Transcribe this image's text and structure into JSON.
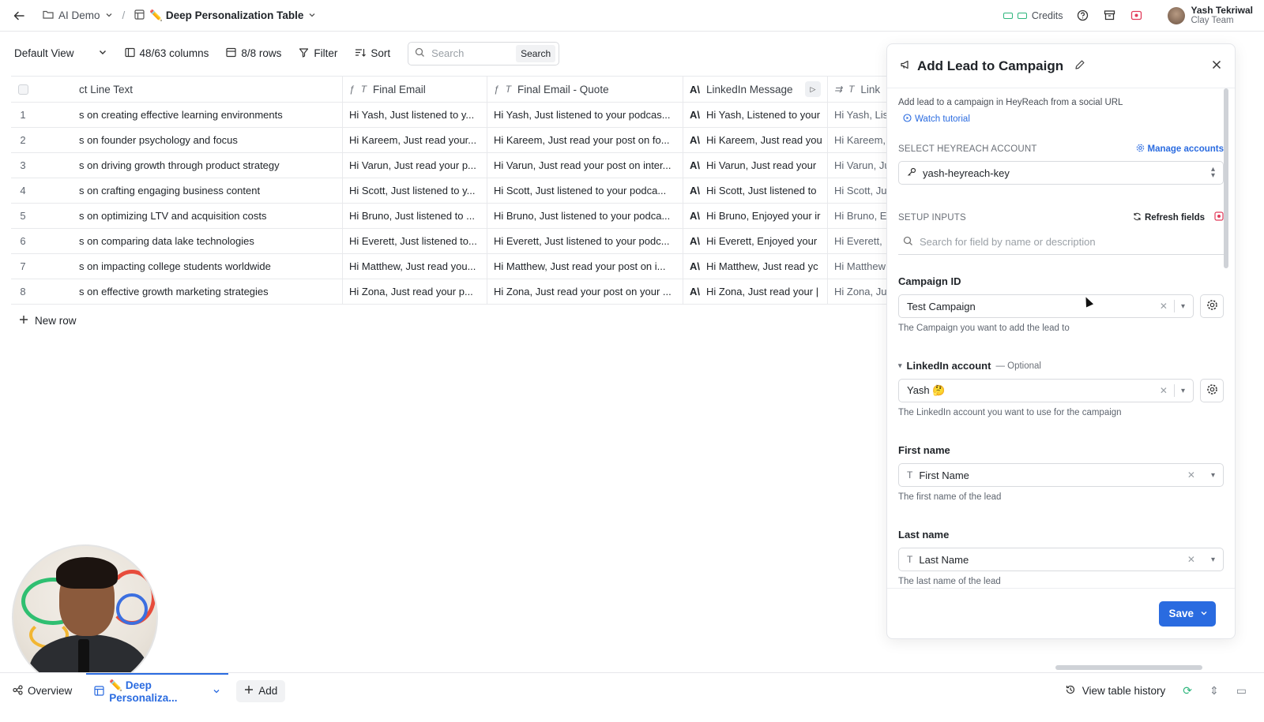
{
  "topbar": {
    "workspace": "AI Demo",
    "table": "✏️ Deep Personalization Table",
    "credits_label": "Credits",
    "user_name": "Yash Tekriwal",
    "user_team": "Clay Team"
  },
  "toolbar": {
    "view": "Default View",
    "columns": "48/63 columns",
    "rows": "8/8 rows",
    "filter": "Filter",
    "sort": "Sort",
    "search_placeholder": "Search",
    "search_button": "Search"
  },
  "grid": {
    "headers": [
      "ct Line Text",
      "Final Email",
      "Final Email - Quote",
      "LinkedIn Message",
      "Link"
    ],
    "rows": [
      {
        "n": "1",
        "c1": "s on creating effective learning environments",
        "c2": "Hi Yash, Just listened to y...",
        "c3": "Hi Yash, Just listened to your podcas...",
        "c4": "Hi Yash, Listened to your",
        "c5": "Hi Yash, Lis"
      },
      {
        "n": "2",
        "c1": "s on founder psychology and focus",
        "c2": "Hi Kareem, Just read your...",
        "c3": "Hi Kareem, Just read your post on fo...",
        "c4": "Hi Kareem, Just read you",
        "c5": "Hi Kareem,"
      },
      {
        "n": "3",
        "c1": "s on driving growth through product strategy",
        "c2": "Hi Varun, Just read your p...",
        "c3": "Hi Varun, Just read your post on inter...",
        "c4": "Hi Varun, Just read your",
        "c5": "Hi Varun, Ju"
      },
      {
        "n": "4",
        "c1": "s on crafting engaging business content",
        "c2": "Hi Scott, Just listened to y...",
        "c3": "Hi Scott, Just listened to your podca...",
        "c4": "Hi Scott, Just listened to",
        "c5": "Hi Scott, Ju"
      },
      {
        "n": "5",
        "c1": "s on optimizing LTV and acquisition costs",
        "c2": "Hi Bruno, Just listened to ...",
        "c3": "Hi Bruno, Just listened to your podca...",
        "c4": "Hi Bruno, Enjoyed your ir",
        "c5": "Hi Bruno, E"
      },
      {
        "n": "6",
        "c1": "s on comparing data lake technologies",
        "c2": "Hi Everett, Just listened to...",
        "c3": "Hi Everett, Just listened to your podc...",
        "c4": "Hi Everett, Enjoyed your",
        "c5": "Hi Everett,"
      },
      {
        "n": "7",
        "c1": "s on impacting college students worldwide",
        "c2": "Hi Matthew, Just read you...",
        "c3": "Hi Matthew, Just read your post on i...",
        "c4": "Hi Matthew, Just read yc",
        "c5": "Hi Matthew"
      },
      {
        "n": "8",
        "c1": "s on effective growth marketing strategies",
        "c2": "Hi Zona, Just read your p...",
        "c3": "Hi Zona, Just read your post on your ...",
        "c4": "Hi Zona, Just read your |",
        "c5": "Hi Zona, Ju"
      }
    ],
    "new_row": "New row"
  },
  "bottombar": {
    "overview": "Overview",
    "active_tab": "✏️ Deep Personaliza...",
    "add": "Add",
    "history": "View table history"
  },
  "panel": {
    "title": "Add Lead to Campaign",
    "description": "Add lead to a campaign in HeyReach from a social URL",
    "tutorial": "Watch tutorial",
    "account_section": "SELECT HEYREACH ACCOUNT",
    "manage_accounts": "Manage accounts",
    "account_value": "yash-heyreach-key",
    "setup_section": "SETUP INPUTS",
    "refresh_fields": "Refresh fields",
    "field_search_placeholder": "Search for field by name or description",
    "fields": {
      "campaign_label": "Campaign ID",
      "campaign_value": "Test Campaign",
      "campaign_help": "The Campaign you want to add the lead to",
      "linkedin_label": "LinkedIn account",
      "linkedin_optional": "— Optional",
      "linkedin_value": "Yash 🤔",
      "linkedin_help": "The LinkedIn account you want to use for the campaign",
      "first_label": "First name",
      "first_value": "First Name",
      "first_help": "The first name of the lead",
      "last_label": "Last name",
      "last_value": "Last Name",
      "last_help": "The last name of the lead"
    },
    "save": "Save"
  },
  "colors": {
    "accent": "#2a6be0",
    "credits_green": "#2eb67d",
    "danger": "#e23b5a"
  }
}
